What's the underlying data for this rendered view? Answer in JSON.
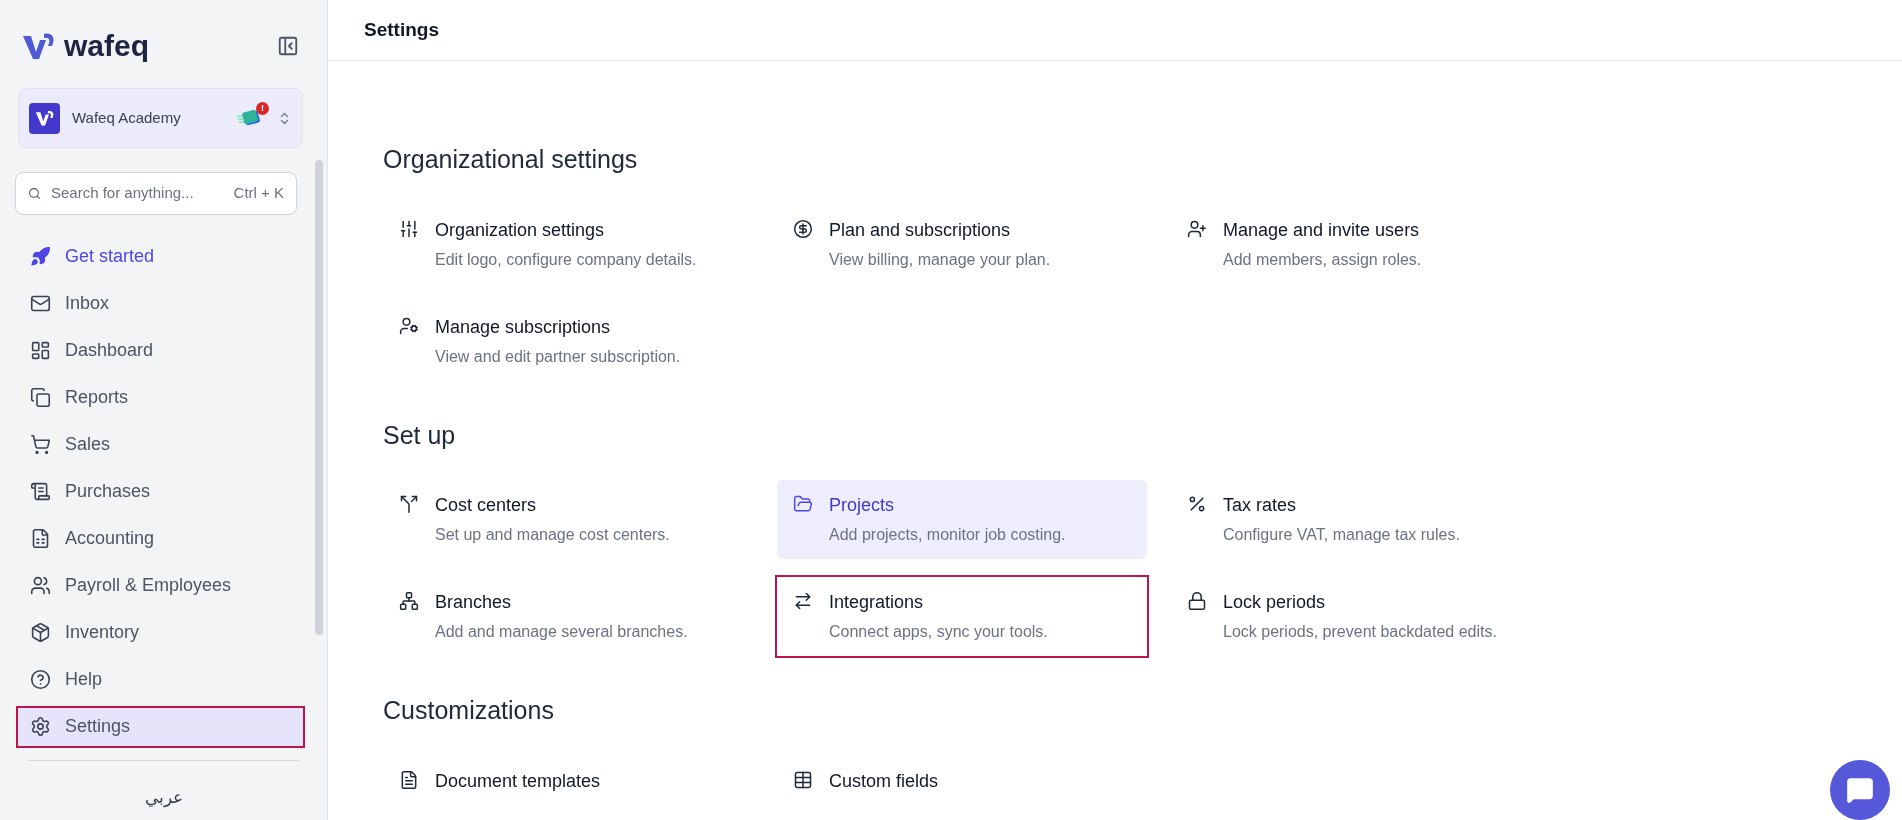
{
  "sidebar": {
    "logo": "wafeq",
    "organization": {
      "name": "Wafeq Academy",
      "alert": "!"
    },
    "search": {
      "placeholder": "Search for anything...",
      "shortcut": "Ctrl + K"
    },
    "items": [
      {
        "label": "Get started",
        "kind": "accent",
        "selected": false,
        "outlined": false
      },
      {
        "label": "Inbox",
        "kind": "plain",
        "selected": false,
        "outlined": false
      },
      {
        "label": "Dashboard",
        "kind": "plain",
        "selected": false,
        "outlined": false
      },
      {
        "label": "Reports",
        "kind": "plain",
        "selected": false,
        "outlined": false
      },
      {
        "label": "Sales",
        "kind": "plain",
        "selected": false,
        "outlined": false
      },
      {
        "label": "Purchases",
        "kind": "plain",
        "selected": false,
        "outlined": false
      },
      {
        "label": "Accounting",
        "kind": "plain",
        "selected": false,
        "outlined": false
      },
      {
        "label": "Payroll & Employees",
        "kind": "plain",
        "selected": false,
        "outlined": false
      },
      {
        "label": "Inventory",
        "kind": "plain",
        "selected": false,
        "outlined": false
      },
      {
        "label": "Help",
        "kind": "plain",
        "selected": false,
        "outlined": false
      },
      {
        "label": "Settings",
        "kind": "plain",
        "selected": true,
        "outlined": true
      }
    ],
    "language": "عربي"
  },
  "header": {
    "title": "Settings"
  },
  "sections": [
    {
      "title": "Organizational settings",
      "items": [
        {
          "title": "Organization settings",
          "description": "Edit logo, configure company details.",
          "selected": false,
          "outlined": false
        },
        {
          "title": "Plan and subscriptions",
          "description": "View billing, manage your plan.",
          "selected": false,
          "outlined": false
        },
        {
          "title": "Manage and invite users",
          "description": "Add members, assign roles.",
          "selected": false,
          "outlined": false
        },
        {
          "title": "Manage subscriptions",
          "description": "View and edit partner subscription.",
          "selected": false,
          "outlined": false
        }
      ]
    },
    {
      "title": "Set up",
      "items": [
        {
          "title": "Cost centers",
          "description": "Set up and manage cost centers.",
          "selected": false,
          "outlined": false
        },
        {
          "title": "Projects",
          "description": "Add projects, monitor job costing.",
          "selected": true,
          "outlined": false
        },
        {
          "title": "Tax rates",
          "description": "Configure VAT, manage tax rules.",
          "selected": false,
          "outlined": false
        },
        {
          "title": "Branches",
          "description": "Add and manage several branches.",
          "selected": false,
          "outlined": false
        },
        {
          "title": "Integrations",
          "description": "Connect apps, sync your tools.",
          "selected": false,
          "outlined": true
        },
        {
          "title": "Lock periods",
          "description": "Lock periods, prevent backdated edits.",
          "selected": false,
          "outlined": false
        }
      ]
    },
    {
      "title": "Customizations",
      "items": [
        {
          "title": "Document templates",
          "selected": false,
          "outlined": false
        },
        {
          "title": "Custom fields",
          "selected": false,
          "outlined": false
        }
      ]
    }
  ]
}
